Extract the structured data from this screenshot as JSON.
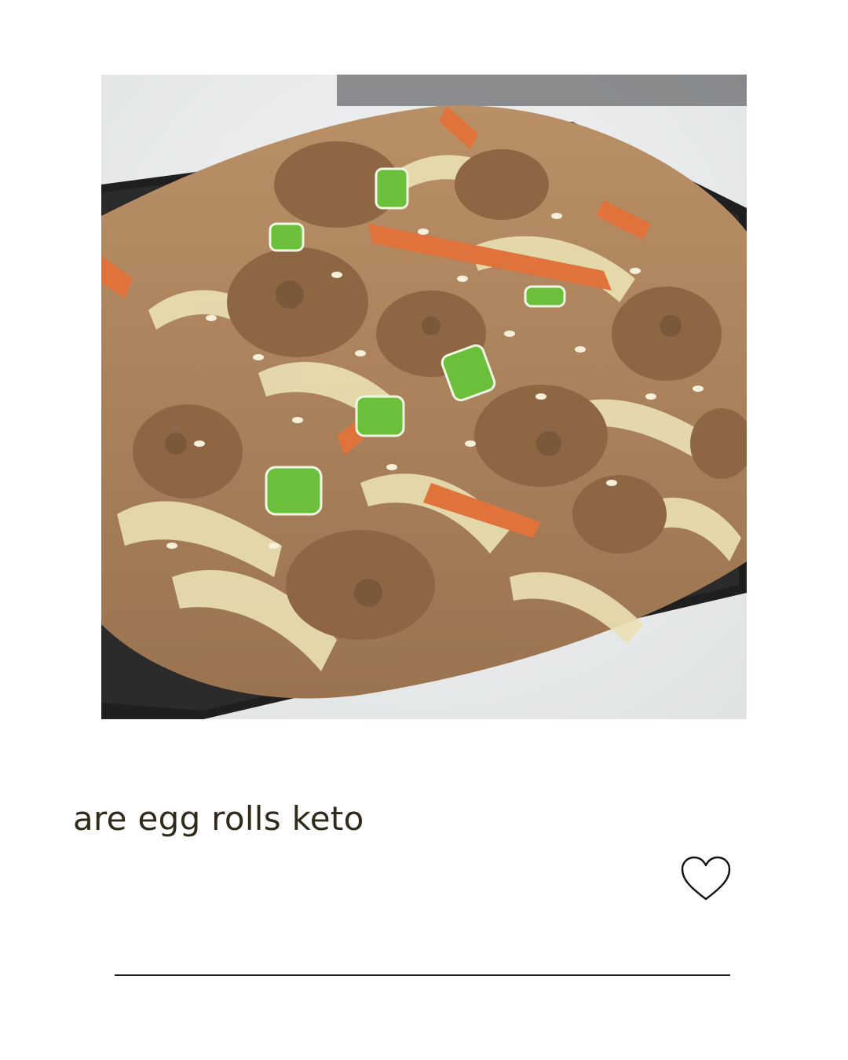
{
  "post": {
    "image": {
      "subject": "stir-fried ground pork with shredded cabbage, carrot, green onion and sesame seeds on a black square plate",
      "alt": "are egg rolls keto"
    },
    "caption": "are egg rolls keto",
    "like_icon": "heart-outline-icon"
  },
  "colors": {
    "background": "#ffffff",
    "caption_text": "#2f2a1a",
    "divider": "#1c1c1c",
    "plate": "#1f1f1f"
  }
}
